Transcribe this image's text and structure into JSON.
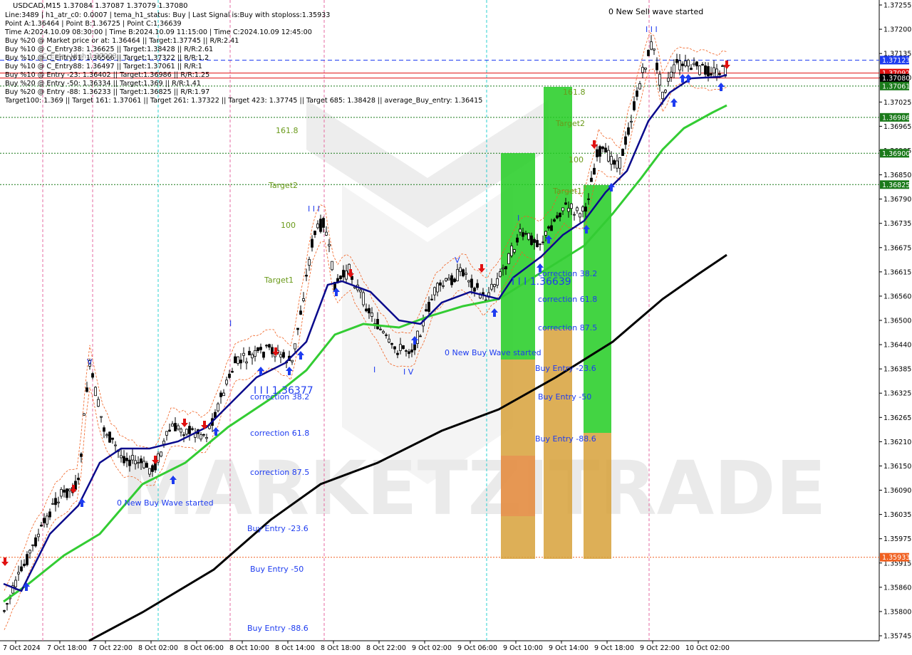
{
  "header": {
    "symbol_line": "USDCAD,M15  1.37084 1.37087 1.37079 1.37080",
    "info_lines": [
      "Line:3489 | h1_atr_c0: 0.0007 | tema_h1_status: Buy | Last Signal is:Buy with stoploss:1.35933",
      "Point A:1.36464 | Point B:1.36725 | Point C:1.36639",
      "Time A:2024.10.09 08:30:00 | Time B:2024.10.09 11:15:00 | Time C:2024.10.09 12:45:00",
      "Buy %20 @ Market price or at: 1.36464 || Target:1.37745 || R/R:2.41",
      "Buy %10 @ C_Entry38: 1.36625 || Target:1.38428 || R/R:2.61",
      "Buy %10 @ C_Entry61: 1.36566 || Target:1.37322 || R/R:1.2",
      "Buy %10 @ C_Entry88: 1.36497 || Target:1.37061 || R/R:1",
      "Buy %10 @ Entry -23: 1.36402 || Target:1.36986 || R/R:1.25",
      "Buy %20 @ Entry -50: 1.36334 || Target:1.369 || R/R:1.41",
      "Buy %20 @ Entry -88: 1.36233 || Target:1.36825 || R/R:1.97",
      "Target100: 1.369 || Target 161: 1.37061 || Target 261: 1.37322 || Target 423: 1.37745 || Target 685: 1.38428 || average_Buy_entry: 1.36415"
    ],
    "overlap_text": "C_Entry High:1.37223"
  },
  "chart_data": {
    "type": "candlestick",
    "symbol": "USDCAD",
    "timeframe": "M15",
    "y_ticks": [
      "1.37255",
      "1.37200",
      "1.37135",
      "1.37080",
      "1.37025",
      "1.36965",
      "1.36905",
      "1.36850",
      "1.36790",
      "1.36735",
      "1.36675",
      "1.36615",
      "1.36560",
      "1.36500",
      "1.36440",
      "1.36385",
      "1.36325",
      "1.36265",
      "1.36210",
      "1.36150",
      "1.36090",
      "1.36035",
      "1.35975",
      "1.35915",
      "1.35860",
      "1.35800",
      "1.35745"
    ],
    "x_ticks": [
      "7 Oct 2024",
      "7 Oct 18:00",
      "7 Oct 22:00",
      "8 Oct 02:00",
      "8 Oct 06:00",
      "8 Oct 10:00",
      "8 Oct 14:00",
      "8 Oct 18:00",
      "8 Oct 22:00",
      "9 Oct 02:00",
      "9 Oct 06:00",
      "9 Oct 10:00",
      "9 Oct 14:00",
      "9 Oct 18:00",
      "9 Oct 22:00",
      "10 Oct 02:00"
    ],
    "price_labels": [
      {
        "value": "1.37123",
        "color": "#1e3cf0"
      },
      {
        "value": "1.37092",
        "color": "#e01010"
      },
      {
        "value": "1.37080",
        "color": "#000000"
      },
      {
        "value": "1.37061",
        "color": "#1a7a1a"
      },
      {
        "value": "1.36986",
        "color": "#1a7a1a"
      },
      {
        "value": "1.36900",
        "color": "#1a7a1a"
      },
      {
        "value": "1.36825",
        "color": "#1a7a1a"
      },
      {
        "value": "1.35933",
        "color": "#f06020"
      }
    ],
    "annotations": [
      "0 New Sell wave started",
      "I I I",
      "161.8",
      "Target2",
      "100",
      "Target1",
      "I I I",
      "V",
      "I",
      "I I I 1.36639",
      "correction 38.2",
      "correction 61.8",
      "correction 87.5",
      "0 New Buy Wave started",
      "Buy Entry -23.6",
      "Buy Entry -50",
      "Buy Entry -88.6",
      "I",
      "I V",
      "V",
      "I",
      "I I I 1.36377",
      "correction 38.2",
      "correction 61.8",
      "correction 87.5",
      "0 New Buy Wave started",
      "Buy Entry -23.6",
      "Buy Entry -50",
      "Buy Entry -88.6",
      "161.8",
      "Target2",
      "100",
      "Target1"
    ],
    "watermark": "MARKETZITRADE"
  },
  "colors": {
    "ma_blue": "#0a0a8c",
    "ma_green": "#33cc33",
    "ma_black": "#000000",
    "up_arrow": "#1e3cf0",
    "down_arrow": "#e01010",
    "zone_green": "#22bb22",
    "zone_orange": "#e8a23a"
  }
}
